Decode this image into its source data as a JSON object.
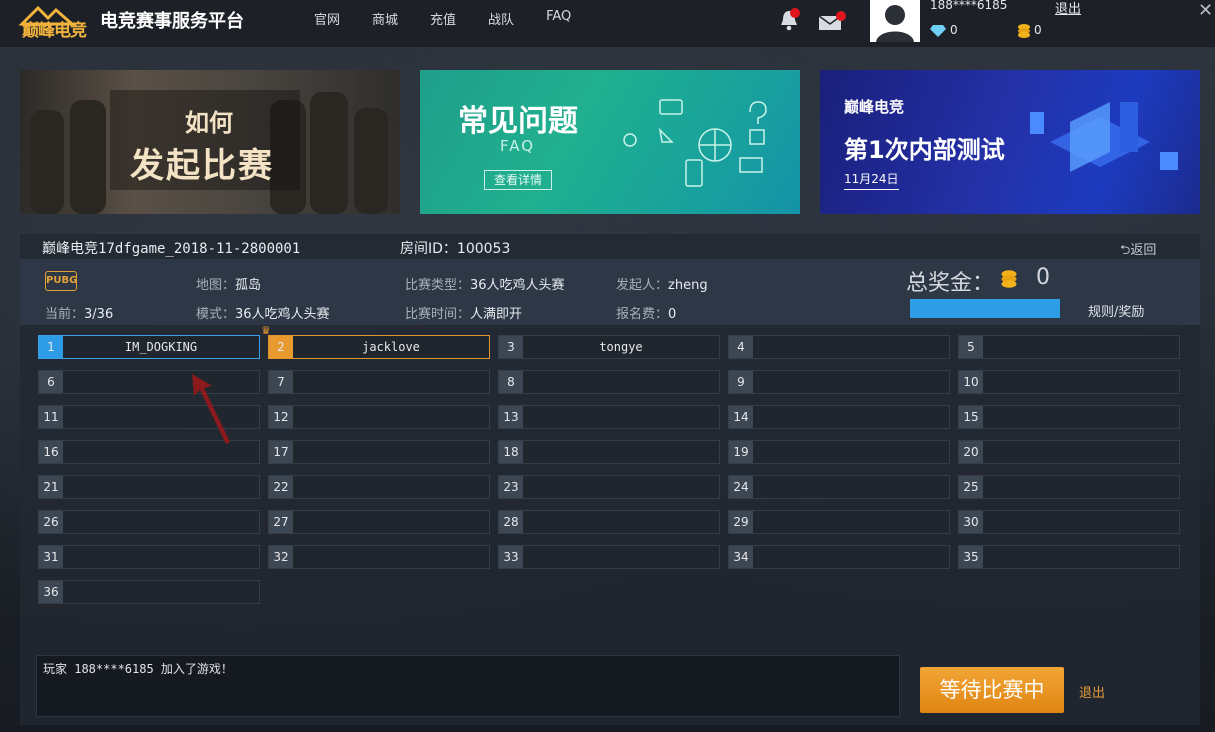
{
  "header": {
    "logo_text": "巅峰电竞",
    "app_title": "电竞赛事服务平台",
    "nav": [
      "官网",
      "商城",
      "充值",
      "战队",
      "FAQ"
    ],
    "user_phone": "188****6185",
    "logout": "退出",
    "diamonds": "0",
    "coins": "0",
    "close": "✕"
  },
  "banners": {
    "b1_line1": "如何",
    "b1_line2": "发起比赛",
    "b2_title": "常见问题",
    "b2_sub": "FAQ",
    "b2_button": "查看详情",
    "b3_logo": "巅峰电竞",
    "b3_title": "第1次内部测试",
    "b3_date": "11月24日"
  },
  "room": {
    "name": "巅峰电竞17dfgame_2018-11-2800001",
    "id": "房间ID：100053",
    "back": "返回",
    "game_badge": "PUBG",
    "current_label": "当前：",
    "current_value": "3/36",
    "map_label": "地图：",
    "map_value": "孤岛",
    "mode_label": "模式：",
    "mode_value": "36人吃鸡人头赛",
    "type_label": "比赛类型：",
    "type_value": "36人吃鸡人头赛",
    "time_label": "比赛时间：",
    "time_value": "人满即开",
    "initiator_label": "发起人：",
    "initiator_value": "zheng",
    "fee_label": "报名费：",
    "fee_value": "0",
    "prize_label": "总奖金：",
    "prize_value": "0",
    "prize_progress": 1.0,
    "rules": "规则/奖励"
  },
  "slots": [
    {
      "num": "1",
      "name": "IM_DOGKING",
      "state": "blue"
    },
    {
      "num": "2",
      "name": "jacklove",
      "state": "orange"
    },
    {
      "num": "3",
      "name": "tongye",
      "state": "none"
    },
    {
      "num": "4",
      "name": "",
      "state": "none"
    },
    {
      "num": "5",
      "name": "",
      "state": "none"
    },
    {
      "num": "6",
      "name": "",
      "state": "none"
    },
    {
      "num": "7",
      "name": "",
      "state": "none"
    },
    {
      "num": "8",
      "name": "",
      "state": "none"
    },
    {
      "num": "9",
      "name": "",
      "state": "none"
    },
    {
      "num": "10",
      "name": "",
      "state": "none"
    },
    {
      "num": "11",
      "name": "",
      "state": "none"
    },
    {
      "num": "12",
      "name": "",
      "state": "none"
    },
    {
      "num": "13",
      "name": "",
      "state": "none"
    },
    {
      "num": "14",
      "name": "",
      "state": "none"
    },
    {
      "num": "15",
      "name": "",
      "state": "none"
    },
    {
      "num": "16",
      "name": "",
      "state": "none"
    },
    {
      "num": "17",
      "name": "",
      "state": "none"
    },
    {
      "num": "18",
      "name": "",
      "state": "none"
    },
    {
      "num": "19",
      "name": "",
      "state": "none"
    },
    {
      "num": "20",
      "name": "",
      "state": "none"
    },
    {
      "num": "21",
      "name": "",
      "state": "none"
    },
    {
      "num": "22",
      "name": "",
      "state": "none"
    },
    {
      "num": "23",
      "name": "",
      "state": "none"
    },
    {
      "num": "24",
      "name": "",
      "state": "none"
    },
    {
      "num": "25",
      "name": "",
      "state": "none"
    },
    {
      "num": "26",
      "name": "",
      "state": "none"
    },
    {
      "num": "27",
      "name": "",
      "state": "none"
    },
    {
      "num": "28",
      "name": "",
      "state": "none"
    },
    {
      "num": "29",
      "name": "",
      "state": "none"
    },
    {
      "num": "30",
      "name": "",
      "state": "none"
    },
    {
      "num": "31",
      "name": "",
      "state": "none"
    },
    {
      "num": "32",
      "name": "",
      "state": "none"
    },
    {
      "num": "33",
      "name": "",
      "state": "none"
    },
    {
      "num": "34",
      "name": "",
      "state": "none"
    },
    {
      "num": "35",
      "name": "",
      "state": "none"
    },
    {
      "num": "36",
      "name": "",
      "state": "none"
    }
  ],
  "chat": {
    "message": "玩家 188****6185 加入了游戏！"
  },
  "actions": {
    "wait": "等待比赛中",
    "exit": "退出"
  },
  "colors": {
    "accent_blue": "#2e9be6",
    "accent_orange": "#e89a2e",
    "notification_red": "#e0151e"
  }
}
